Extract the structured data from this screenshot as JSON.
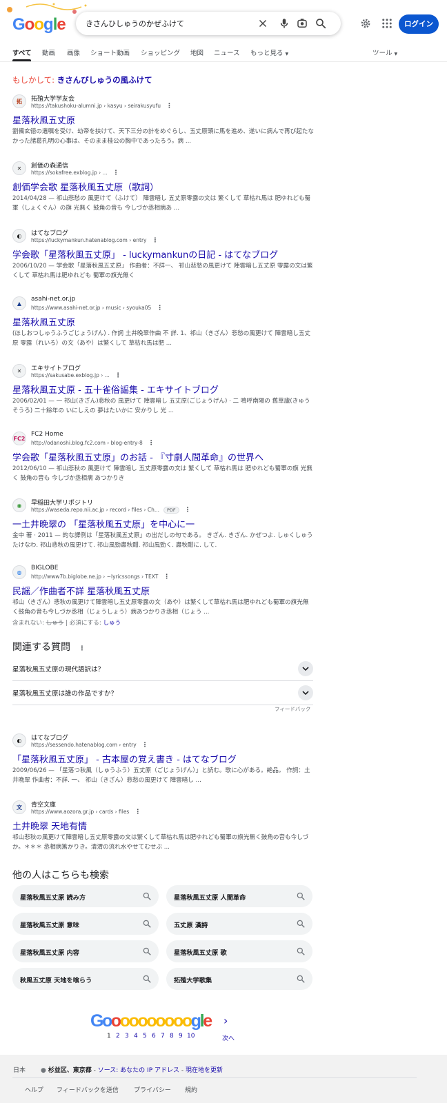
{
  "header": {
    "logo": "Google",
    "search_query": "きさんひしゅうのかぜふけて",
    "login_label": "ログイン",
    "icons": [
      "clear-icon",
      "mic-icon",
      "lens-icon",
      "search-icon",
      "gear-icon",
      "apps-icon"
    ]
  },
  "tabs": [
    {
      "label": "すべて",
      "active": true
    },
    {
      "label": "動画"
    },
    {
      "label": "画像"
    },
    {
      "label": "ショート動画"
    },
    {
      "label": "ショッピング"
    },
    {
      "label": "地図"
    },
    {
      "label": "ニュース"
    },
    {
      "label": "もっと見る"
    }
  ],
  "tools_label": "ツール",
  "did_you_mean": {
    "prefix": "もしかして: ",
    "suggestion": "きさんびしゅうの風ふけて"
  },
  "results": [
    {
      "site": "拓殖大学学友会",
      "url": "https://takushoku-alumni.jp › kasyu › seirakusyufu",
      "title": "星落秋風五丈原",
      "snippet": "劉備玄徳の遺嘱を受け、幼帝を扶けて、天下三分の計をめぐらし、五丈原頭に馬を進め、遂いに病んで再び起たなかった諸葛孔明の心事は、そのまま桂公の胸中であったろう。病 ...",
      "favicon": "拓",
      "favicon_color": "#b8401e"
    },
    {
      "site": "創価の森通信",
      "url": "https://sokafree.exblog.jp › ...",
      "title": "創価学会歌 星落秋風五丈原（歌詞）",
      "snippet": "2014/04/28 — 祁山悲愁の 風更けて（ふけて） 陣雲暗し 五丈原零露の文は 繁くして 草枯れ馬は 肥ゆれども蜀軍（しょくぐん）の旗 光無く 鼓角の音も 今しづか丞相病あ ...",
      "favicon": "✕",
      "favicon_color": "#333333"
    },
    {
      "site": "はてなブログ",
      "url": "https://luckymankun.hatenablog.com › entry",
      "title": "学会歌「星落秋風五丈原」 - luckymankunの日記 - はてなブログ",
      "snippet": "2006/10/20 — 学会歌「星落秋風五丈原」 作曲者：不詳一、 祁山悲愁の風更けて 陣雲暗し五丈原 零露の文は繁くして 草枯れ馬は肥ゆれども 蜀軍の旗光無く",
      "favicon": "◐",
      "favicon_color": "#222222"
    },
    {
      "site": "asahi-net.or.jp",
      "url": "https://www.asahi-net.or.jp › music › syouka05",
      "title": "星落秋風五丈原",
      "snippet": "(ほしおつしゅうふうごじょうげん) . 作詞 土井晩翠作曲 不 詳. 1、祁山（きざん）悲愁の風更けて 陣雲暗し五丈原 零露（れいろ）の文（あや）は繁くして 草枯れ馬は肥 ...",
      "favicon": "▲",
      "favicon_color": "#1b3f8f"
    },
    {
      "site": "エキサイトブログ",
      "url": "https://sakusabe.exblog.jp › ...",
      "title": "星落秋風五丈原 - 五十雀俗謡集 - エキサイトブログ",
      "snippet": "2006/02/01 — 一 祁山(きざん)悲秋の 風更けて 陣雲暗し 五丈原(ごじょうげん) · 二 鳴呼南陽の 舊草廬(きゅうそうろ) 二十餘年の いにしえの 夢はたいかに 安かりし 光 ...",
      "favicon": "✕",
      "favicon_color": "#333333"
    },
    {
      "site": "FC2 Home",
      "url": "http://odanoshi.blog.fc2.com › blog-entry-8",
      "title": "学会歌「星落秋風五丈原」のお話 - 『寸劇人間革命』の世界へ",
      "snippet": "2012/06/10 — 祁山悲秋の 風更けて 陣雲暗し 五丈原零露の文は 繁くして 草枯れ馬は 肥ゆれども蜀軍の旗 光無く 鼓角の音も 今しづか丞相病 あつかりき",
      "favicon": "FC2",
      "favicon_color": "#c2185b"
    },
    {
      "site": "早稲田大学リポジトリ",
      "url": "https://waseda.repo.nii.ac.jp › record › files › Ch...",
      "pdf": "PDF",
      "title": "一土井晩翠の 「星落秋風五丈原」を中心に一",
      "snippet": "金中 著 · 2011 — 的な譯例は「星落秋風五丈原」の出だしの句である。 きざん. きざん. かぜつよ. しゅくしゅうたけなわ. 祁山悲秋の風更けて. 祁山風勁肅秋酣. 祁山風勁く. 肅秋酣に. して.",
      "favicon": "◉",
      "favicon_color": "#3c9a3c"
    },
    {
      "site": "BIGLOBE",
      "url": "http://www7b.biglobe.ne.jp › ~lyricssongs › TEXT",
      "title": "民謡／作曲者不詳 星落秋風五丈原",
      "snippet": "祁山（きざん）悲秋の風更けて陣雲暗し五丈原零露の文（あや）は繁くして草枯れ馬は肥ゆれども蜀軍の旗光無く鼓角の音も今しづか丞相（じょうしょう）病あつかりき丞相（じょう ...",
      "favicon": "◍",
      "favicon_color": "#1a73e8",
      "missing_label": "含まれない:",
      "missing_term": "しゅう",
      "must_include_label": "| 必須にする:",
      "must_include_term": "しゅう"
    }
  ],
  "paa": {
    "heading": "関連する質問",
    "questions": [
      "星落秋風五丈原の現代語訳は？",
      "星落秋風五丈原は誰の作品ですか？"
    ],
    "feedback": "フィードバック"
  },
  "results2": [
    {
      "site": "はてなブログ",
      "url": "https://sessendo.hatenablog.com › entry",
      "title": "「星落秋風五丈原」 - 古本屋の覚え書き - はてなブログ",
      "snippet": "2009/06/26 — 「星落つ秋風（しゅうふう）五丈原（ごじょうげん）」と読む。歌に心がある。絶品。 作詞：土井晩翠 作曲者：不詳. 一、 祁山（きざん）悲愁の風更けて 陣雲暗し ...",
      "favicon": "◐",
      "favicon_color": "#222222"
    },
    {
      "site": "青空文庫",
      "url": "https://www.aozora.gr.jp › cards › files",
      "title": "土井晩翠 天地有情",
      "snippet": "祁山悲秋の風更けて陣雲暗し五丈原零露の文は繁くして草枯れ馬は肥ゆれども蜀軍の旗光無く鼓角の音も今しづか。＊＊＊ 丞相病篤かりき。清渭の流れ水やせてむせぶ ...",
      "favicon": "文",
      "favicon_color": "#1e3a8a"
    }
  ],
  "related": {
    "heading": "他の人はこちらも検索",
    "items": [
      "星落秋風五丈原 読み方",
      "星落秋風五丈原 人間革命",
      "星落秋風五丈原 意味",
      "五丈原 漢詩",
      "星落秋風五丈原 内容",
      "星落秋風五丈原 歌",
      "秋風五丈原 天地を喰らう",
      "拓殖大学歌集"
    ]
  },
  "pagination": {
    "logo": "Goooooooooogle",
    "pages": [
      "1",
      "2",
      "3",
      "4",
      "5",
      "6",
      "7",
      "8",
      "9",
      "10"
    ],
    "current": "1",
    "next_label": "次へ"
  },
  "footer": {
    "country": "日本",
    "location": "杉並区、東京都",
    "location_sep": " - ",
    "source_link": "ソース: あなたの IP アドレス",
    "update_link": "現在地を更新",
    "links": [
      "ヘルプ",
      "フィードバックを送信",
      "プライバシー",
      "規約"
    ]
  },
  "colors": {
    "accent": "#0b57d0",
    "link": "#1a0dab",
    "did_you_mean_prefix": "#ea4335"
  }
}
